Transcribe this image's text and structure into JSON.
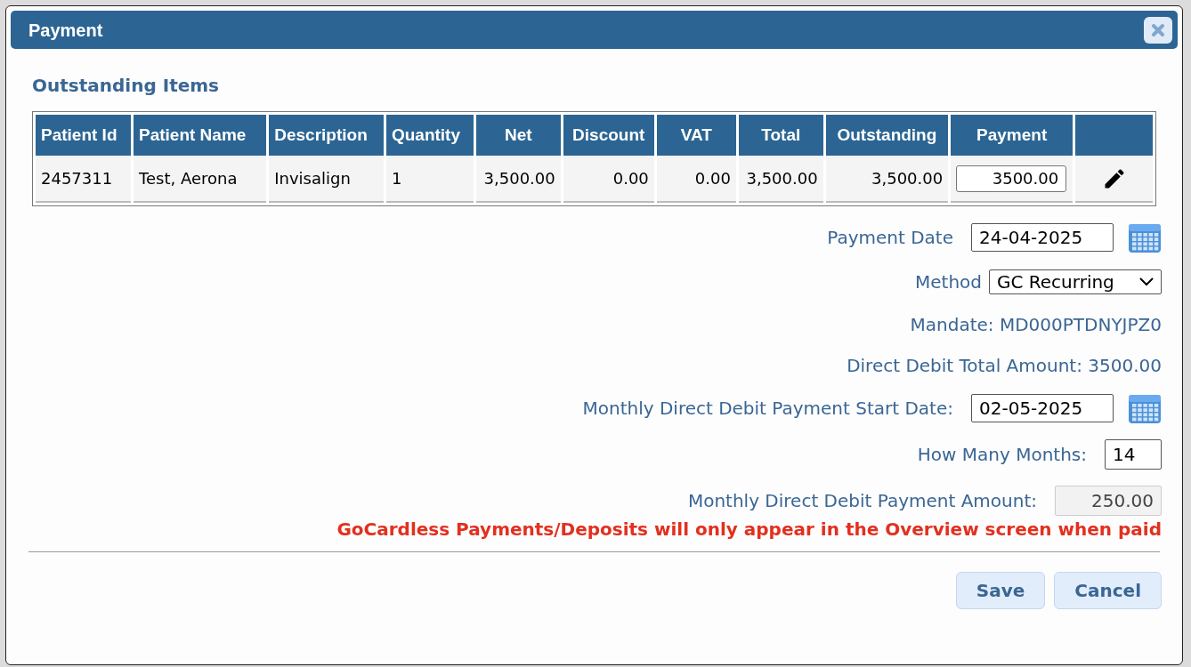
{
  "dialog": {
    "title": "Payment"
  },
  "section_title": "Outstanding Items",
  "table": {
    "columns": [
      "Patient Id",
      "Patient Name",
      "Description",
      "Quantity",
      "Net",
      "Discount",
      "VAT",
      "Total",
      "Outstanding",
      "Payment"
    ],
    "rows": [
      {
        "cells": [
          "2457311",
          "Test, Aerona",
          "Invisalign",
          "1",
          "3,500.00",
          "0.00",
          "0.00",
          "3,500.00",
          "3,500.00"
        ],
        "payment": "3500.00"
      }
    ]
  },
  "form": [
    {
      "kind": "date",
      "label": "Payment Date",
      "value": "24-04-2025"
    },
    {
      "kind": "select",
      "label": "Method",
      "value": "GC Recurring"
    },
    {
      "kind": "text",
      "label": "Mandate: MD000PTDNYJPZ0"
    },
    {
      "kind": "text",
      "label": "Direct Debit Total Amount: 3500.00"
    },
    {
      "kind": "date",
      "label": "Monthly Direct Debit Payment Start Date:",
      "value": "02-05-2025"
    },
    {
      "kind": "number",
      "label": "How Many Months:",
      "value": "14"
    },
    {
      "kind": "readonly",
      "label": "Monthly Direct Debit Payment Amount:",
      "value": "250.00"
    }
  ],
  "warning": "GoCardless Payments/Deposits will only appear in the Overview screen when paid",
  "buttons": [
    "Save",
    "Cancel"
  ]
}
